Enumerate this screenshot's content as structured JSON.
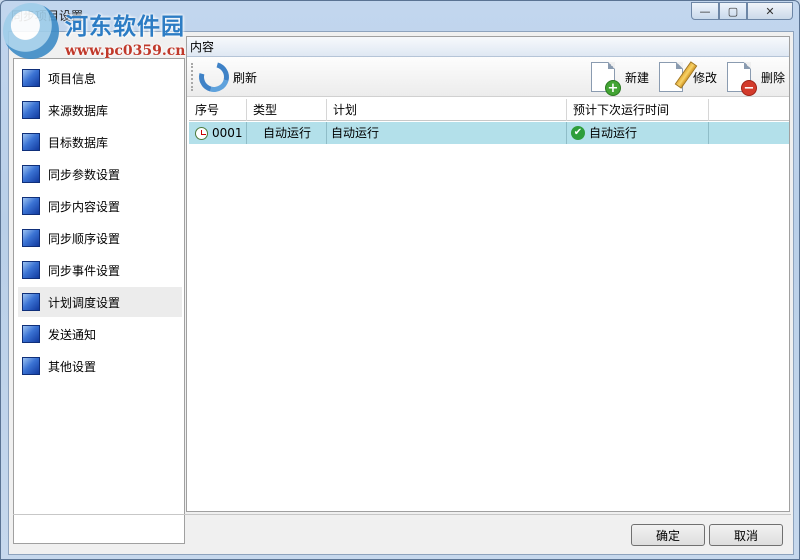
{
  "window": {
    "title": "同步项目设置",
    "controls": {
      "minimize": "—",
      "maximize": "▢",
      "close": "✕"
    }
  },
  "watermark": {
    "name": "河东软件园",
    "url": "www.pc0359.cn"
  },
  "sidebar": {
    "items": [
      {
        "label": "项目信息"
      },
      {
        "label": "来源数据库"
      },
      {
        "label": "目标数据库"
      },
      {
        "label": "同步参数设置"
      },
      {
        "label": "同步内容设置"
      },
      {
        "label": "同步顺序设置"
      },
      {
        "label": "同步事件设置"
      },
      {
        "label": "计划调度设置"
      },
      {
        "label": "发送通知"
      },
      {
        "label": "其他设置"
      }
    ],
    "selected_index": 7
  },
  "content": {
    "header": "内容",
    "toolbar": {
      "refresh": "刷新",
      "new": "新建",
      "edit": "修改",
      "delete": "删除"
    },
    "table": {
      "columns": [
        "序号",
        "类型",
        "计划",
        "预计下次运行时间"
      ],
      "rows": [
        {
          "id": "0001",
          "type": "自动运行",
          "plan": "自动运行",
          "next_run": "自动运行"
        }
      ]
    }
  },
  "footer": {
    "ok": "确定",
    "cancel": "取消"
  }
}
